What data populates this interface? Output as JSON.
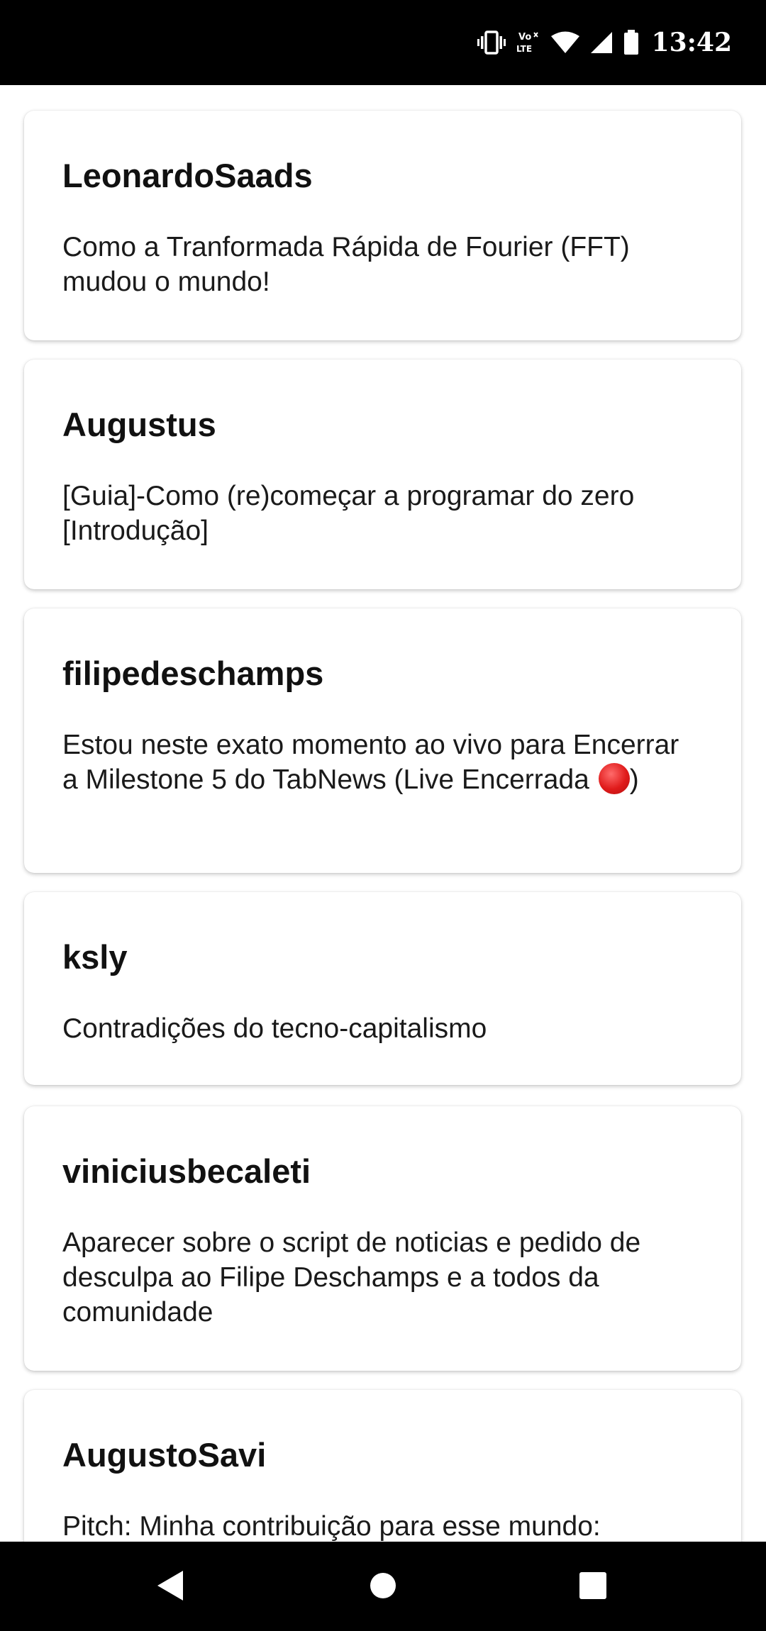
{
  "status_bar": {
    "time": "13:42",
    "icons": [
      "vibrate-icon",
      "volte-icon",
      "wifi-icon",
      "cell-signal-icon",
      "battery-icon"
    ],
    "volte_top": "Vo",
    "volte_bottom": "LTE"
  },
  "posts": [
    {
      "author": "LeonardoSaads",
      "title": "Como a Tranformada Rápida de Fourier (FFT) mudou o mundo!"
    },
    {
      "author": "Augustus",
      "title": "[Guia]-Como (re)começar  a programar do zero [Introdução]"
    },
    {
      "author": "filipedeschamps",
      "title": "Estou neste exato momento ao vivo para Encerrar a Milestone 5 do TabNews (Live Encerrada ",
      "title_suffix": ")",
      "live_icon": "red-circle-icon"
    },
    {
      "author": "ksly",
      "title": "Contradições do tecno-capitalismo"
    },
    {
      "author": "viniciusbecaleti",
      "title": "Aparecer sobre o script de noticias e pedido de desculpa ao Filipe Deschamps e a todos da comunidade"
    },
    {
      "author": "AugustoSavi",
      "title": "Pitch: Minha contribuição para esse mundo:"
    }
  ],
  "nav_bar": {
    "icons": [
      "back-icon",
      "home-icon",
      "recents-icon"
    ]
  },
  "colors": {
    "status_bar_bg": "#000000",
    "nav_bar_bg": "#000000",
    "card_bg": "#ffffff",
    "text": "#111111",
    "live_dot": "#e01b1b"
  }
}
